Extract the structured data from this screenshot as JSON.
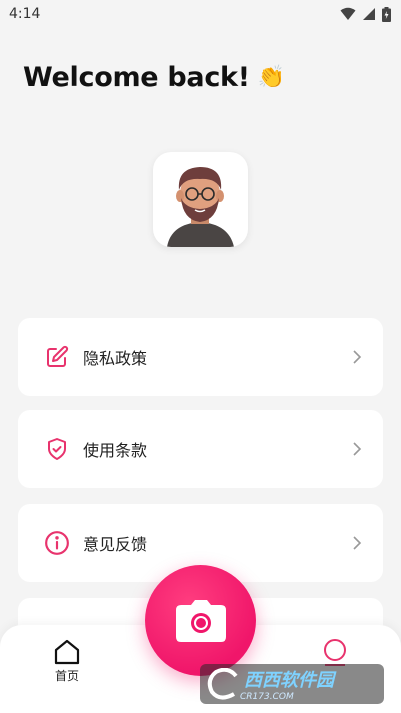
{
  "status_bar": {
    "time": "4:14",
    "icons": [
      "wifi-icon",
      "signal-icon",
      "battery-icon"
    ]
  },
  "header": {
    "title": "Welcome back!",
    "emoji": "👏"
  },
  "menu": {
    "items": [
      {
        "label": "隐私政策",
        "icon": "edit-icon"
      },
      {
        "label": "使用条款",
        "icon": "shield-check-icon"
      },
      {
        "label": "意见反馈",
        "icon": "info-icon"
      }
    ]
  },
  "bottom_nav": {
    "home_label": "首页",
    "profile_icon": "profile-icon",
    "camera_icon": "camera-icon"
  },
  "watermark": {
    "text": "西西软件园",
    "sub": "CR173.COM"
  },
  "colors": {
    "accent": "#e8336d",
    "camera_button": "#f0166a",
    "background": "#f4f4f4"
  }
}
